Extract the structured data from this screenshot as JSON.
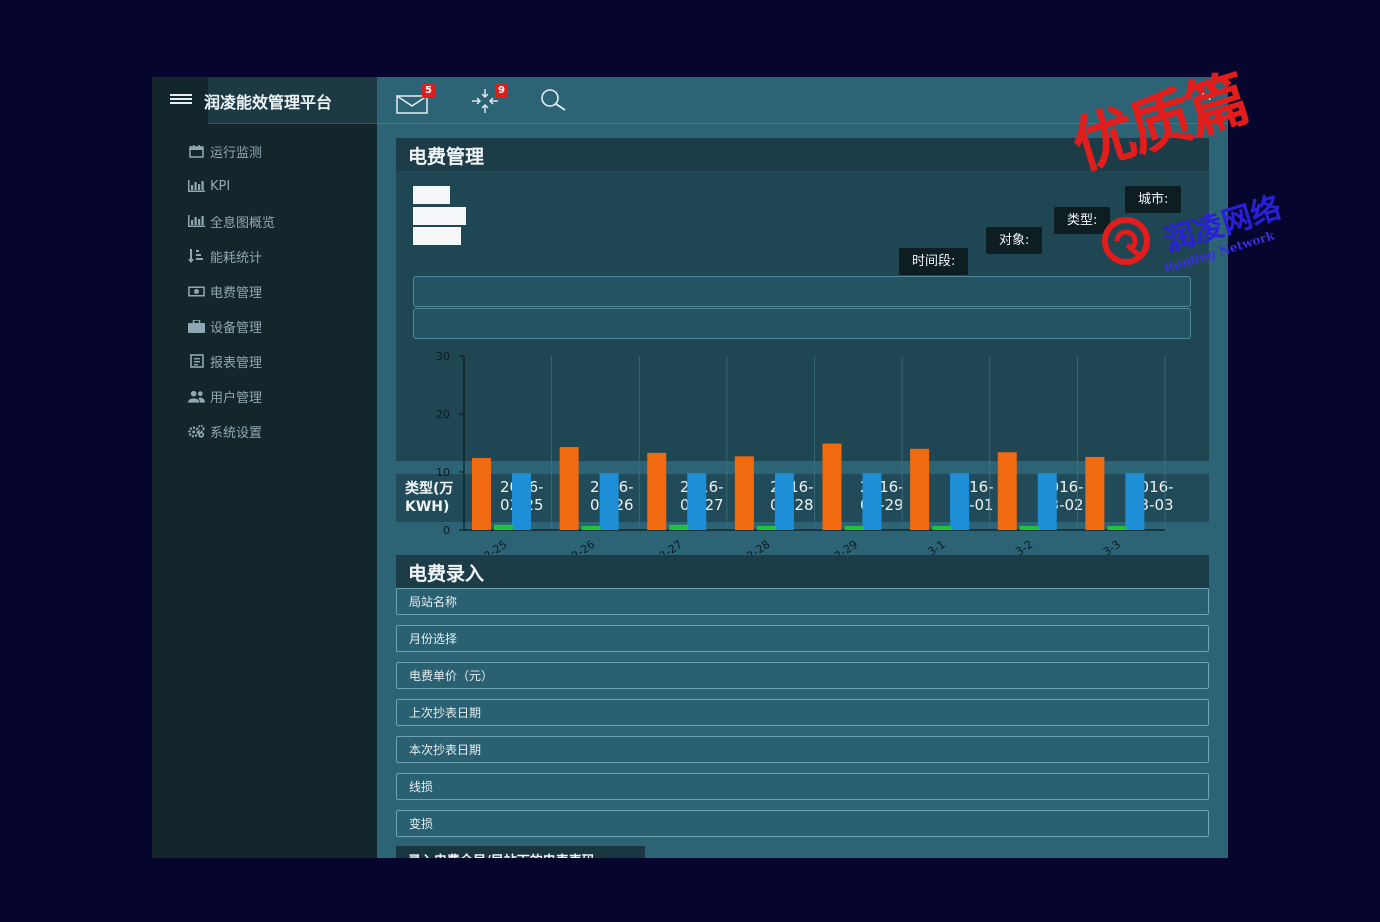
{
  "app": {
    "title": "润凌能效管理平台"
  },
  "sidebar": {
    "items": [
      {
        "label": "运行监测",
        "icon": "calendar-icon"
      },
      {
        "label": "KPI",
        "icon": "bar-chart-icon"
      },
      {
        "label": "全息图概览",
        "icon": "bar-chart-icon"
      },
      {
        "label": "能耗统计",
        "icon": "sort-list-icon"
      },
      {
        "label": "电费管理",
        "icon": "money-icon"
      },
      {
        "label": "设备管理",
        "icon": "briefcase-icon"
      },
      {
        "label": "报表管理",
        "icon": "report-icon"
      },
      {
        "label": "用户管理",
        "icon": "users-icon"
      },
      {
        "label": "系统设置",
        "icon": "gears-icon"
      }
    ]
  },
  "topbar": {
    "mail_badge": "5",
    "tasks_badge": "9",
    "more": "::"
  },
  "panel1": {
    "title": "电费管理",
    "tags": {
      "city": "城市:",
      "type": "类型:",
      "target": "对象:",
      "period": "时间段:"
    }
  },
  "chart_data": {
    "type": "bar",
    "categories": [
      "2-25",
      "2-26",
      "2-27",
      "2-28",
      "2-29",
      "3-1",
      "3-2",
      "3-3"
    ],
    "ylim": [
      0,
      30
    ],
    "yticks": [
      "0",
      "10",
      "20",
      "30"
    ],
    "series": [
      {
        "color": "#f26a10",
        "values": [
          12.4,
          14.3,
          13.3,
          12.7,
          14.9,
          14.0,
          13.4,
          12.6
        ]
      },
      {
        "color": "#1e8fd6",
        "values": [
          9.8,
          9.8,
          9.8,
          9.8,
          9.8,
          9.8,
          9.8,
          9.8
        ]
      },
      {
        "color": "#22c33c",
        "values": [
          0.9,
          0.7,
          0.9,
          0.5,
          0.7,
          0.7,
          0.7,
          0.5
        ]
      }
    ]
  },
  "date_row": {
    "label": "类型(万KWH)",
    "dates": [
      "2016-02-25",
      "2016-02-26",
      "2016-02-27",
      "2016-02-28",
      "2016-02-29",
      "2016-03-01",
      "2016-03-02",
      "2016-03-03"
    ]
  },
  "panel2": {
    "title": "电费录入",
    "fields": [
      "局站名称",
      "月份选择",
      "电费单价（元）",
      "上次抄表日期",
      "本次抄表日期",
      "线损",
      "变损"
    ],
    "upload_label": "录入电费全局/局站下的电表表码"
  },
  "stamp": {
    "big": "优质篇",
    "sub": "润凌网络",
    "en": "Runling Network"
  },
  "colors": {
    "accent_red": "#d9201c",
    "bar_orange": "#f26a10",
    "bar_blue": "#1e8fd6",
    "bar_green": "#22c33c"
  }
}
